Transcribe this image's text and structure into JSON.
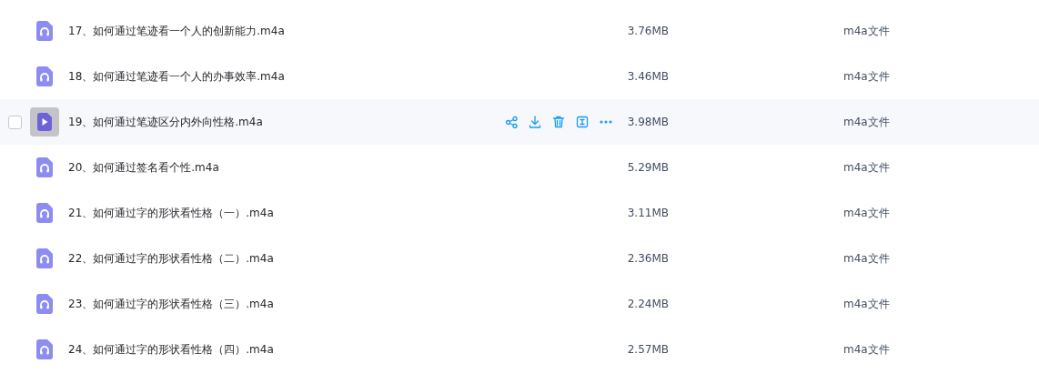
{
  "files": [
    {
      "name": "17、如何通过笔迹看一个人的创新能力.m4a",
      "size": "3.76MB",
      "type": "m4a文件",
      "hovered": false,
      "checked": false
    },
    {
      "name": "18、如何通过笔迹看一个人的办事效率.m4a",
      "size": "3.46MB",
      "type": "m4a文件",
      "hovered": false,
      "checked": false
    },
    {
      "name": "19、如何通过笔迹区分内外向性格.m4a",
      "size": "3.98MB",
      "type": "m4a文件",
      "hovered": true,
      "checked": false
    },
    {
      "name": "20、如何通过签名看个性.m4a",
      "size": "5.29MB",
      "type": "m4a文件",
      "hovered": false,
      "checked": false
    },
    {
      "name": "21、如何通过字的形状看性格（一）.m4a",
      "size": "3.11MB",
      "type": "m4a文件",
      "hovered": false,
      "checked": false
    },
    {
      "name": "22、如何通过字的形状看性格（二）.m4a",
      "size": "2.36MB",
      "type": "m4a文件",
      "hovered": false,
      "checked": false
    },
    {
      "name": "23、如何通过字的形状看性格（三）.m4a",
      "size": "2.24MB",
      "type": "m4a文件",
      "hovered": false,
      "checked": false
    },
    {
      "name": "24、如何通过字的形状看性格（四）.m4a",
      "size": "2.57MB",
      "type": "m4a文件",
      "hovered": false,
      "checked": false
    }
  ]
}
